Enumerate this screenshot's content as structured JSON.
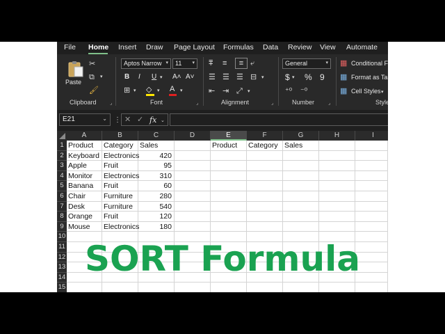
{
  "menu": {
    "items": [
      "File",
      "Home",
      "Insert",
      "Draw",
      "Page Layout",
      "Formulas",
      "Data",
      "Review",
      "View",
      "Automate"
    ],
    "active": "Home"
  },
  "ribbon": {
    "clipboard": {
      "paste_label": "Paste",
      "group_label": "Clipboard"
    },
    "font": {
      "font_name": "Aptos Narrow",
      "font_size": "11",
      "bold": "B",
      "italic": "I",
      "underline": "U",
      "grow": "A˄",
      "shrink": "A˅",
      "font_color_glyph": "A",
      "group_label": "Font"
    },
    "alignment": {
      "group_label": "Alignment"
    },
    "number": {
      "format": "General",
      "currency": "$",
      "percent": "%",
      "comma": "9",
      "group_label": "Number"
    },
    "styles": {
      "conditional": "Conditional F",
      "format_table": "Format as Ta",
      "cell_styles": "Cell Styles",
      "group_label": "Style"
    }
  },
  "formula_bar": {
    "name_box": "E21",
    "fx": "fx",
    "value": ""
  },
  "sheet": {
    "columns": [
      "A",
      "B",
      "C",
      "D",
      "E",
      "F",
      "G",
      "H",
      "I"
    ],
    "selected_column": "E",
    "rows": [
      "1",
      "2",
      "3",
      "4",
      "5",
      "6",
      "7",
      "8",
      "9",
      "10",
      "11",
      "12",
      "13",
      "14",
      "15"
    ],
    "headers": [
      "Product",
      "Category",
      "Sales"
    ],
    "data": [
      [
        "Keyboard",
        "Electronics",
        "420"
      ],
      [
        "Apple",
        "Fruit",
        "95"
      ],
      [
        "Monitor",
        "Electronics",
        "310"
      ],
      [
        "Banana",
        "Fruit",
        "60"
      ],
      [
        "Chair",
        "Furniture",
        "280"
      ],
      [
        "Desk",
        "Furniture",
        "540"
      ],
      [
        "Orange",
        "Fruit",
        "120"
      ],
      [
        "Mouse",
        "Electronics",
        "180"
      ]
    ],
    "output_headers": [
      "Product",
      "Category",
      "Sales"
    ]
  },
  "overlay_title": "SORT Formula",
  "colors": {
    "title": "#1aa251",
    "accent": "#7fc08a",
    "ribbon_bg": "#292929"
  }
}
